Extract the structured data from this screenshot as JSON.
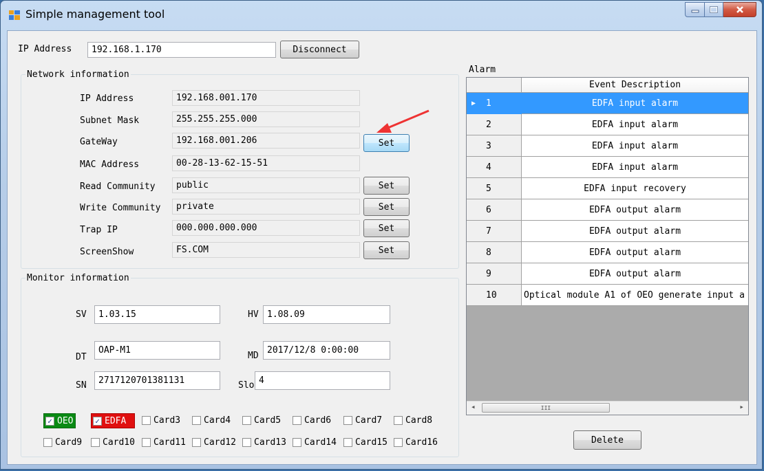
{
  "window": {
    "title": "Simple management tool"
  },
  "top": {
    "ip_label": "IP Address",
    "ip_value": "192.168.1.170",
    "disconnect": "Disconnect"
  },
  "network": {
    "legend": "Network information",
    "ip_label": "IP Address",
    "ip_value": "192.168.001.170",
    "mask_label": "Subnet Mask",
    "mask_value": "255.255.255.000",
    "gw_label": "GateWay",
    "gw_value": "192.168.001.206",
    "mac_label": "MAC Address",
    "mac_value": "00-28-13-62-15-51",
    "rc_label": "Read Community",
    "rc_value": "public",
    "wc_label": "Write Community",
    "wc_value": "private",
    "trap_label": "Trap IP",
    "trap_value": "000.000.000.000",
    "ss_label": "ScreenShow",
    "ss_value": "FS.COM",
    "set": "Set"
  },
  "monitor": {
    "legend": "Monitor information",
    "sv_label": "SV",
    "sv_value": "1.03.15",
    "hv_label": "HV",
    "hv_value": "1.08.09",
    "dt_label": "DT",
    "dt_value": "OAP-M1",
    "md_label": "MD",
    "md_value": "2017/12/8 0:00:00",
    "sn_label": "SN",
    "sn_value": "2717120701381131",
    "slot_label": "Slot",
    "slot_value": "4",
    "cards": [
      {
        "label": "OEO",
        "checked": true,
        "color": "#0a8a14"
      },
      {
        "label": "EDFA",
        "checked": true,
        "color": "#e01010"
      },
      {
        "label": "Card3",
        "checked": false
      },
      {
        "label": "Card4",
        "checked": false
      },
      {
        "label": "Card5",
        "checked": false
      },
      {
        "label": "Card6",
        "checked": false
      },
      {
        "label": "Card7",
        "checked": false
      },
      {
        "label": "Card8",
        "checked": false
      },
      {
        "label": "Card9",
        "checked": false
      },
      {
        "label": "Card10",
        "checked": false
      },
      {
        "label": "Card11",
        "checked": false
      },
      {
        "label": "Card12",
        "checked": false
      },
      {
        "label": "Card13",
        "checked": false
      },
      {
        "label": "Card14",
        "checked": false
      },
      {
        "label": "Card15",
        "checked": false
      },
      {
        "label": "Card16",
        "checked": false
      }
    ]
  },
  "alarm": {
    "legend": "Alarm",
    "column": "Event Description",
    "rows": [
      {
        "n": "1",
        "desc": "EDFA input alarm"
      },
      {
        "n": "2",
        "desc": "EDFA input alarm"
      },
      {
        "n": "3",
        "desc": "EDFA input alarm"
      },
      {
        "n": "4",
        "desc": "EDFA input alarm"
      },
      {
        "n": "5",
        "desc": "EDFA input recovery"
      },
      {
        "n": "6",
        "desc": "EDFA output alarm"
      },
      {
        "n": "7",
        "desc": "EDFA output alarm"
      },
      {
        "n": "8",
        "desc": "EDFA output alarm"
      },
      {
        "n": "9",
        "desc": "EDFA output alarm"
      },
      {
        "n": "10",
        "desc": "Optical module A1 of OEO generate input a"
      }
    ],
    "selected_row": 1,
    "delete": "Delete"
  },
  "icons": {
    "scroll_left": "◂",
    "scroll_right": "▸",
    "row_pointer": "▶",
    "grip": "III",
    "check": "✓"
  }
}
